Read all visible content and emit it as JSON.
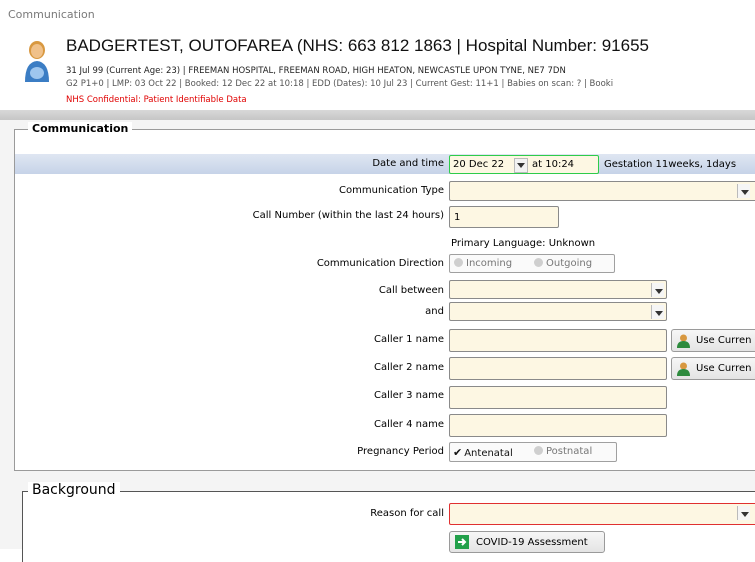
{
  "window": {
    "title": "Communication"
  },
  "patient": {
    "name_line": "BADGERTEST, OUTOFAREA (NHS: 663 812 1863 | Hospital Number: 91655",
    "details_line": "31 Jul 99 (Current Age: 23) | FREEMAN HOSPITAL, FREEMAN ROAD, HIGH HEATON, NEWCASTLE UPON TYNE, NE7 7DN",
    "pregnancy_line": "G2 P1+0  | LMP: 03 Oct 22 | Booked: 12 Dec 22 at 10:18 | EDD (Dates): 10 Jul 23 | Current Gest: 11+1 | Babies on scan: ? | Booki",
    "confidential": "NHS Confidential:  Patient Identifiable Data",
    "icon": "patient-person-icon"
  },
  "communication": {
    "legend": "Communication",
    "date_time_label": "Date and time",
    "date_value": "20 Dec 22",
    "time_value": "at 10:24",
    "gestation": "Gestation 11weeks, 1days",
    "communication_type_label": "Communication Type",
    "communication_type_value": "",
    "call_number_label": "Call Number (within the last 24 hours)",
    "call_number_value": "1",
    "primary_language": "Primary Language: Unknown",
    "direction_label": "Communication Direction",
    "direction_options": [
      "Incoming",
      "Outgoing"
    ],
    "call_between_label": "Call between",
    "and_label": "and",
    "caller1_label": "Caller 1 name",
    "caller2_label": "Caller 2 name",
    "caller3_label": "Caller 3 name",
    "caller4_label": "Caller 4 name",
    "use_current_label": "Use Curren",
    "pregnancy_period_label": "Pregnancy Period",
    "pregnancy_period_options": [
      "Antenatal",
      "Postnatal"
    ],
    "pregnancy_period_selected": "Antenatal"
  },
  "background": {
    "legend": "Background",
    "reason_label": "Reason for call",
    "covid_button": "COVID-19 Assessment"
  },
  "colors": {
    "header_bg": "#ffffff",
    "datetime_row": "#c6d3e8",
    "field_bg": "#fdf7e3",
    "confidential_text": "#e00000",
    "required_border": "#e03030",
    "date_border": "#2ecc4a",
    "covid_icon": "#22a04a"
  }
}
